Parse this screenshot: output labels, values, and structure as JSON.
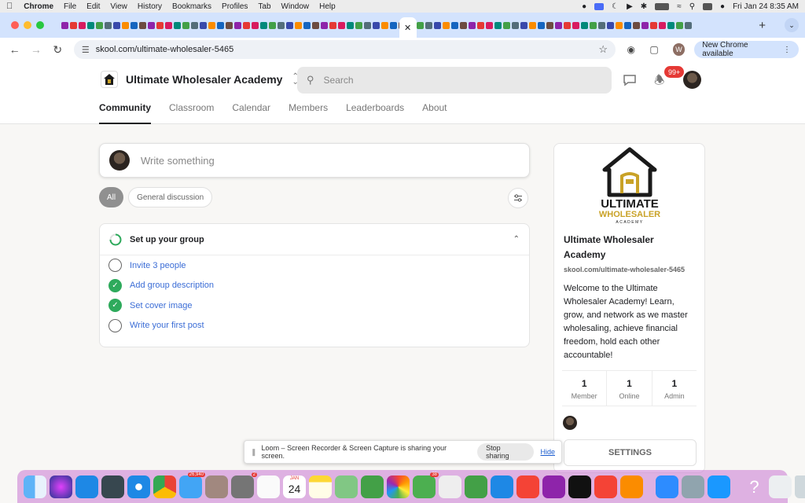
{
  "menubar": {
    "app": "Chrome",
    "items": [
      "File",
      "Edit",
      "View",
      "History",
      "Bookmarks",
      "Profiles",
      "Tab",
      "Window",
      "Help"
    ],
    "datetime": "Fri Jan 24  8:35 AM"
  },
  "browser": {
    "url": "skool.com/ultimate-wholesaler-5465",
    "profile_initial": "W",
    "update_label": "New Chrome available",
    "active_tab_close": "✕",
    "new_tab": "+"
  },
  "site": {
    "group_name": "Ultimate Wholesaler Academy",
    "search_placeholder": "Search",
    "notification_count": "99+",
    "tabs": [
      "Community",
      "Classroom",
      "Calendar",
      "Members",
      "Leaderboards",
      "About"
    ]
  },
  "feed": {
    "composer_placeholder": "Write something",
    "filters": [
      "All",
      "General discussion"
    ],
    "setup": {
      "title": "Set up your group",
      "tasks": [
        {
          "label": "Invite 3 people",
          "done": false
        },
        {
          "label": "Add group description",
          "done": true
        },
        {
          "label": "Set cover image",
          "done": true
        },
        {
          "label": "Write your first post",
          "done": false
        }
      ]
    }
  },
  "sidebar": {
    "logo_text_top": "ULTIMATE",
    "logo_text_mid": "WHOLESALER",
    "logo_text_bottom": "ACADEMY",
    "name": "Ultimate Wholesaler Academy",
    "url": "skool.com/ultimate-wholesaler-5465",
    "description": "Welcome to the Ultimate Wholesaler Academy! Learn, grow, and network as we master wholesaling, achieve financial freedom, hold each other accountable!",
    "stats": [
      {
        "value": "1",
        "label": "Member"
      },
      {
        "value": "1",
        "label": "Online"
      },
      {
        "value": "1",
        "label": "Admin"
      }
    ],
    "settings_label": "SETTINGS"
  },
  "loom": {
    "message": "Loom – Screen Recorder & Screen Capture is sharing your screen.",
    "stop_label": "Stop sharing",
    "hide_label": "Hide"
  },
  "dock": {
    "mail_badge": "26,940",
    "settings_badge": "2",
    "calendar_month": "JAN",
    "calendar_day": "24",
    "messages_badge": "38"
  },
  "colors": {
    "accent_link": "#3b6dd6",
    "check_done": "#2eaa5c",
    "badge_red": "#e53935",
    "logo_gold": "#c9a227"
  }
}
